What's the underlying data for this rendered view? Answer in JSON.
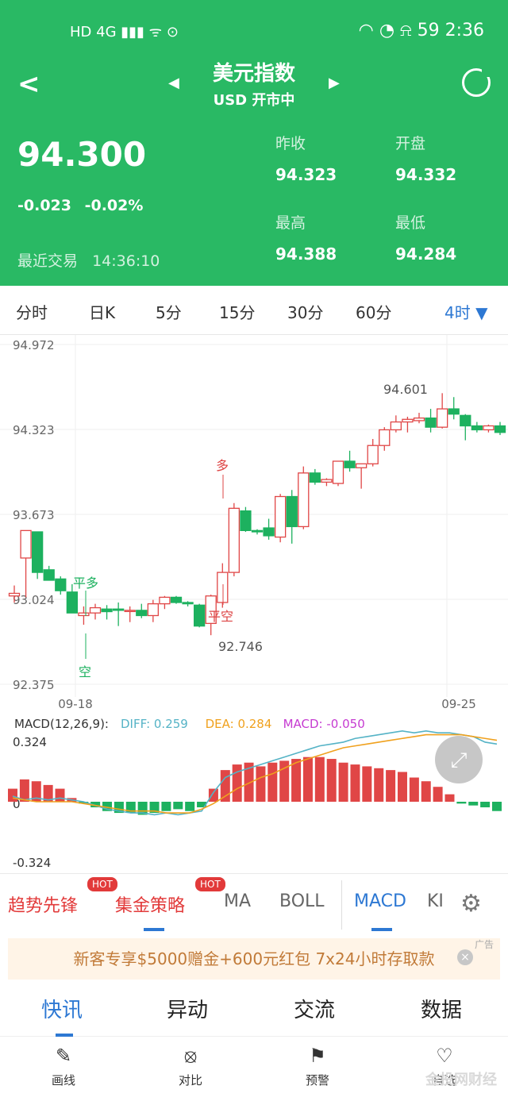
{
  "status": {
    "left": "HD 4G ▮▮▮ ᯤ ⊙",
    "right": "◠ ◔ ⍾ 59 2:36"
  },
  "header": {
    "title": "美元指数",
    "subtitle": "USD 开市中"
  },
  "quote": {
    "price": "94.300",
    "change": "-0.023",
    "change_pct": "-0.02%",
    "trade_label": "最近交易",
    "trade_time": "14:36:10",
    "stats": [
      {
        "label": "昨收",
        "value": "94.323"
      },
      {
        "label": "开盘",
        "value": "94.332"
      },
      {
        "label": "最高",
        "value": "94.388"
      },
      {
        "label": "最低",
        "value": "94.284"
      }
    ]
  },
  "timeframes": [
    "分时",
    "日K",
    "5分",
    "15分",
    "30分",
    "60分",
    "4时 ▼"
  ],
  "chart_data": [
    {
      "type": "candlestick",
      "y_labels": [
        "94.972",
        "94.323",
        "93.673",
        "93.024",
        "92.375"
      ],
      "x_labels": [
        "09-18",
        "09-25"
      ],
      "ylim": [
        92.375,
        94.972
      ],
      "candles": [
        {
          "o": 93.05,
          "h": 93.13,
          "l": 93.0,
          "c": 93.07
        },
        {
          "o": 93.34,
          "h": 93.37,
          "l": 93.04,
          "c": 93.55
        },
        {
          "o": 93.54,
          "h": 93.53,
          "l": 93.18,
          "c": 93.23
        },
        {
          "o": 93.25,
          "h": 93.28,
          "l": 93.18,
          "c": 93.17
        },
        {
          "o": 93.18,
          "h": 93.2,
          "l": 93.06,
          "c": 93.09
        },
        {
          "o": 93.08,
          "h": 93.14,
          "l": 92.93,
          "c": 92.92
        },
        {
          "o": 92.9,
          "h": 92.97,
          "l": 92.83,
          "c": 92.92
        },
        {
          "o": 92.92,
          "h": 92.99,
          "l": 92.87,
          "c": 92.96
        },
        {
          "o": 92.95,
          "h": 92.98,
          "l": 92.87,
          "c": 92.93
        },
        {
          "o": 92.95,
          "h": 93.0,
          "l": 92.82,
          "c": 92.94
        },
        {
          "o": 92.94,
          "h": 92.97,
          "l": 92.85,
          "c": 92.94
        },
        {
          "o": 92.94,
          "h": 92.99,
          "l": 92.88,
          "c": 92.9
        },
        {
          "o": 92.9,
          "h": 93.02,
          "l": 92.85,
          "c": 92.99
        },
        {
          "o": 92.99,
          "h": 93.05,
          "l": 92.95,
          "c": 93.04
        },
        {
          "o": 93.04,
          "h": 93.05,
          "l": 92.99,
          "c": 93.0
        },
        {
          "o": 93.0,
          "h": 93.01,
          "l": 92.97,
          "c": 92.99
        },
        {
          "o": 92.98,
          "h": 92.99,
          "l": 92.81,
          "c": 92.82
        },
        {
          "o": 92.84,
          "h": 93.06,
          "l": 92.75,
          "c": 93.05
        },
        {
          "o": 93.0,
          "h": 93.3,
          "l": 92.96,
          "c": 93.23
        },
        {
          "o": 93.23,
          "h": 93.76,
          "l": 93.2,
          "c": 93.72
        },
        {
          "o": 93.7,
          "h": 93.73,
          "l": 93.54,
          "c": 93.55
        },
        {
          "o": 93.55,
          "h": 93.56,
          "l": 93.52,
          "c": 93.54
        },
        {
          "o": 93.57,
          "h": 93.64,
          "l": 93.48,
          "c": 93.51
        },
        {
          "o": 93.5,
          "h": 93.83,
          "l": 93.46,
          "c": 93.81
        },
        {
          "o": 93.81,
          "h": 93.86,
          "l": 93.45,
          "c": 93.58
        },
        {
          "o": 93.58,
          "h": 94.04,
          "l": 93.56,
          "c": 93.99
        },
        {
          "o": 93.99,
          "h": 94.02,
          "l": 93.9,
          "c": 93.92
        },
        {
          "o": 93.92,
          "h": 93.95,
          "l": 93.89,
          "c": 93.94
        },
        {
          "o": 93.91,
          "h": 94.08,
          "l": 93.89,
          "c": 94.08
        },
        {
          "o": 94.08,
          "h": 94.16,
          "l": 94.0,
          "c": 94.03
        },
        {
          "o": 94.03,
          "h": 94.06,
          "l": 93.87,
          "c": 94.06
        },
        {
          "o": 94.06,
          "h": 94.25,
          "l": 94.04,
          "c": 94.2
        },
        {
          "o": 94.2,
          "h": 94.34,
          "l": 94.16,
          "c": 94.32
        },
        {
          "o": 94.32,
          "h": 94.43,
          "l": 94.3,
          "c": 94.38
        },
        {
          "o": 94.38,
          "h": 94.42,
          "l": 94.3,
          "c": 94.4
        },
        {
          "o": 94.39,
          "h": 94.45,
          "l": 94.37,
          "c": 94.41
        },
        {
          "o": 94.41,
          "h": 94.48,
          "l": 94.3,
          "c": 94.34
        },
        {
          "o": 94.34,
          "h": 94.6,
          "l": 94.33,
          "c": 94.48
        },
        {
          "o": 94.48,
          "h": 94.57,
          "l": 94.4,
          "c": 94.44
        },
        {
          "o": 94.43,
          "h": 94.44,
          "l": 94.24,
          "c": 94.35
        },
        {
          "o": 94.35,
          "h": 94.38,
          "l": 94.3,
          "c": 94.32
        },
        {
          "o": 94.32,
          "h": 94.36,
          "l": 94.3,
          "c": 94.35
        },
        {
          "o": 94.35,
          "h": 94.38,
          "l": 94.28,
          "c": 94.3
        }
      ],
      "annotations": [
        {
          "text": "94.601"
        },
        {
          "text": "92.746"
        },
        {
          "text": "多"
        },
        {
          "text": "平空"
        },
        {
          "text": "平多"
        },
        {
          "text": "空"
        }
      ]
    },
    {
      "type": "bar",
      "title": "MACD(12,26,9):",
      "legend": [
        {
          "label": "DIFF: 0.259",
          "color": "#55b3c6"
        },
        {
          "label": "DEA: 0.284",
          "color": "#f0a11e"
        },
        {
          "label": "MACD: -0.050",
          "color": "#c63bd1"
        }
      ],
      "y_labels": [
        "0.324",
        "0",
        "-0.324"
      ],
      "ylim": [
        -0.324,
        0.324
      ],
      "bars": [
        0.07,
        0.12,
        0.11,
        0.09,
        0.07,
        0.02,
        -0.01,
        -0.03,
        -0.05,
        -0.06,
        -0.06,
        -0.07,
        -0.06,
        -0.05,
        -0.04,
        -0.05,
        -0.03,
        0.07,
        0.17,
        0.2,
        0.21,
        0.19,
        0.21,
        0.22,
        0.23,
        0.24,
        0.24,
        0.23,
        0.21,
        0.2,
        0.19,
        0.18,
        0.17,
        0.16,
        0.13,
        0.11,
        0.08,
        0.04,
        -0.01,
        -0.02,
        -0.03,
        -0.05
      ],
      "diff": [
        0.03,
        0.01,
        0.02,
        0.01,
        0.02,
        0.01,
        0.0,
        -0.02,
        -0.04,
        -0.05,
        -0.06,
        -0.06,
        -0.07,
        -0.06,
        -0.07,
        -0.06,
        -0.05,
        0.05,
        0.13,
        0.16,
        0.18,
        0.2,
        0.22,
        0.24,
        0.26,
        0.28,
        0.3,
        0.31,
        0.32,
        0.34,
        0.35,
        0.36,
        0.37,
        0.38,
        0.37,
        0.38,
        0.37,
        0.37,
        0.36,
        0.35,
        0.32,
        0.31
      ],
      "dea": [
        0.02,
        0.01,
        0.0,
        0.0,
        0.0,
        0.0,
        -0.01,
        -0.02,
        -0.03,
        -0.04,
        -0.05,
        -0.05,
        -0.05,
        -0.06,
        -0.06,
        -0.06,
        -0.04,
        -0.01,
        0.03,
        0.07,
        0.1,
        0.13,
        0.15,
        0.18,
        0.21,
        0.23,
        0.25,
        0.27,
        0.29,
        0.3,
        0.31,
        0.32,
        0.33,
        0.34,
        0.35,
        0.36,
        0.36,
        0.36,
        0.36,
        0.35,
        0.34,
        0.33
      ]
    }
  ],
  "indicator_tabs": [
    {
      "label": "趋势先锋",
      "color": "#e23a3a",
      "badge": "HOT"
    },
    {
      "label": "集金策略",
      "color": "#e23a3a",
      "badge": "HOT"
    },
    {
      "label": "MA",
      "color": "#666666"
    },
    {
      "label": "BOLL",
      "color": "#666666"
    },
    {
      "label": "MACD",
      "color": "#2d78d3"
    },
    {
      "label": "KI",
      "color": "#666666"
    }
  ],
  "ad": {
    "text": "新客专享$5000赠金+600元红包  7x24小时存取款",
    "close": "×",
    "tag": "广告"
  },
  "news_tabs": [
    "快讯",
    "异动",
    "交流",
    "数据"
  ],
  "toolbar": [
    {
      "label": "画线",
      "icon": "✎"
    },
    {
      "label": "对比",
      "icon": "⦻"
    },
    {
      "label": "预警",
      "icon": "⚑"
    },
    {
      "label": "自选",
      "icon": "♡"
    }
  ],
  "watermark": "金投网财经",
  "colors": {
    "header": "#29b964",
    "up": "#e04646",
    "down": "#1db15f",
    "accent": "#2d78d3"
  }
}
